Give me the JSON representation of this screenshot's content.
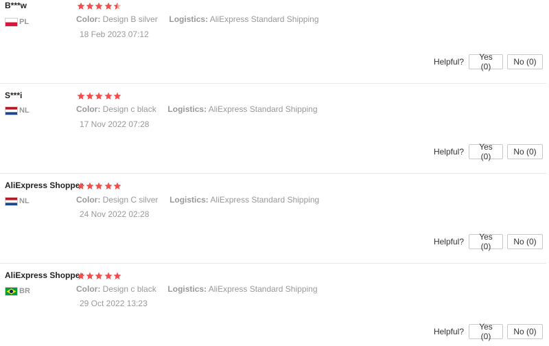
{
  "colors": {
    "star": "#f54c4c",
    "meta_text": "#999999",
    "divider": "#e8e8e8"
  },
  "labels": {
    "color_key": "Color:",
    "logistics_key": "Logistics:",
    "helpful": "Helpful?"
  },
  "reviews": [
    {
      "name": "B***w",
      "country": "PL",
      "flag": "poland-flag",
      "rating": 4.5,
      "color": "Design B silver",
      "logistics": "AliExpress Standard Shipping",
      "date": "18 Feb 2023 07:12",
      "yes": "Yes (0)",
      "no": "No (0)"
    },
    {
      "name": "S***i",
      "country": "NL",
      "flag": "netherlands-flag",
      "rating": 5,
      "color": "Design c black",
      "logistics": "AliExpress Standard Shipping",
      "date": "17 Nov 2022 07:28",
      "yes": "Yes (0)",
      "no": "No (0)"
    },
    {
      "name": "AliExpress Shopper",
      "country": "NL",
      "flag": "netherlands-flag",
      "rating": 5,
      "color": "Design C silver",
      "logistics": "AliExpress Standard Shipping",
      "date": "24 Nov 2022 02:28",
      "yes": "Yes (0)",
      "no": "No (0)"
    },
    {
      "name": "AliExpress Shopper",
      "country": "BR",
      "flag": "brazil-flag",
      "rating": 5,
      "color": "Design c black",
      "logistics": "AliExpress Standard Shipping",
      "date": "29 Oct 2022 13:23",
      "yes": "Yes (0)",
      "no": "No (0)"
    }
  ]
}
